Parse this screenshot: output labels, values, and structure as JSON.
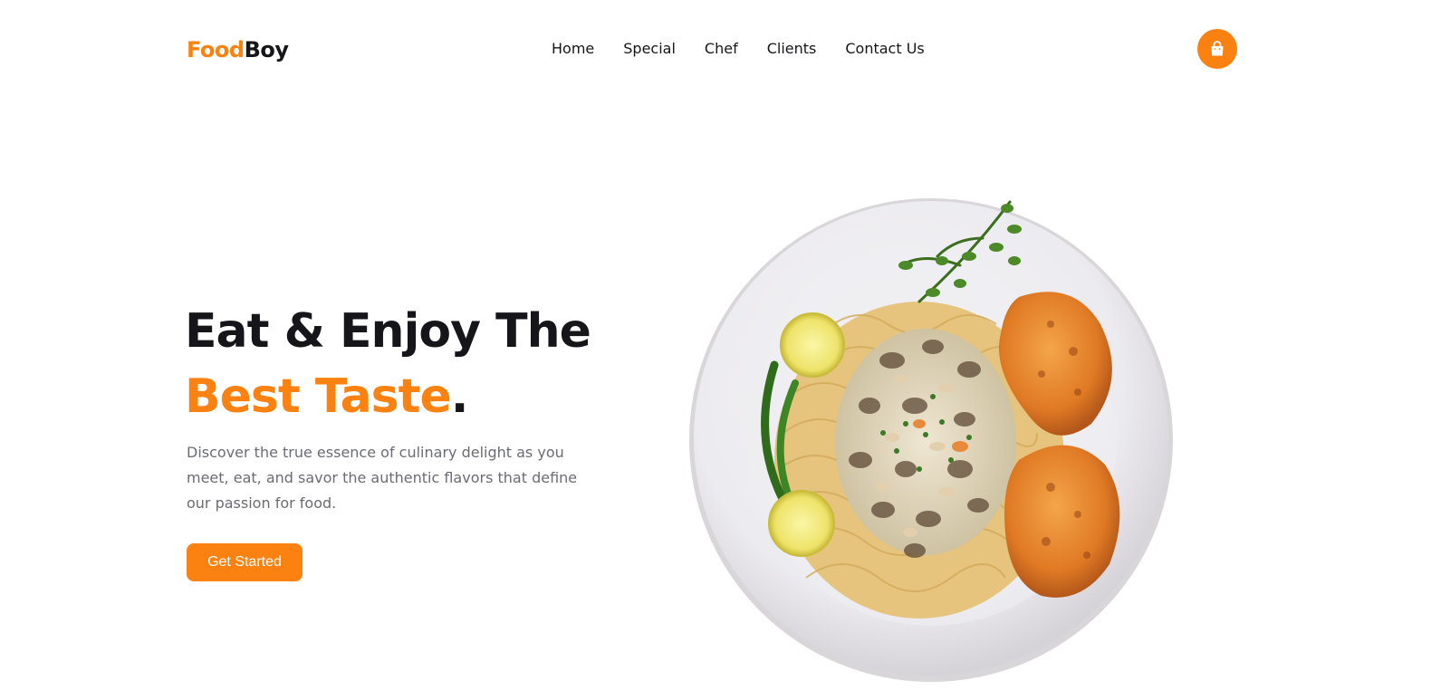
{
  "brand": {
    "part1": "Food",
    "part2": "Boy"
  },
  "nav": {
    "items": [
      {
        "label": "Home"
      },
      {
        "label": "Special"
      },
      {
        "label": "Chef"
      },
      {
        "label": "Clients"
      },
      {
        "label": "Contact Us"
      }
    ],
    "cart_icon": "shopping-bag-icon"
  },
  "hero": {
    "title_line1": "Eat & Enjoy The",
    "title_line2": "Best Taste",
    "title_end": ".",
    "description": "Discover the true essence of culinary delight as you meet, eat, and savor the authentic flavors that define our passion for food.",
    "cta_label": "Get Started",
    "image": "pasta-plate-image"
  },
  "colors": {
    "accent": "#fb8210",
    "text": "#16161a",
    "muted": "#6b6b74"
  }
}
